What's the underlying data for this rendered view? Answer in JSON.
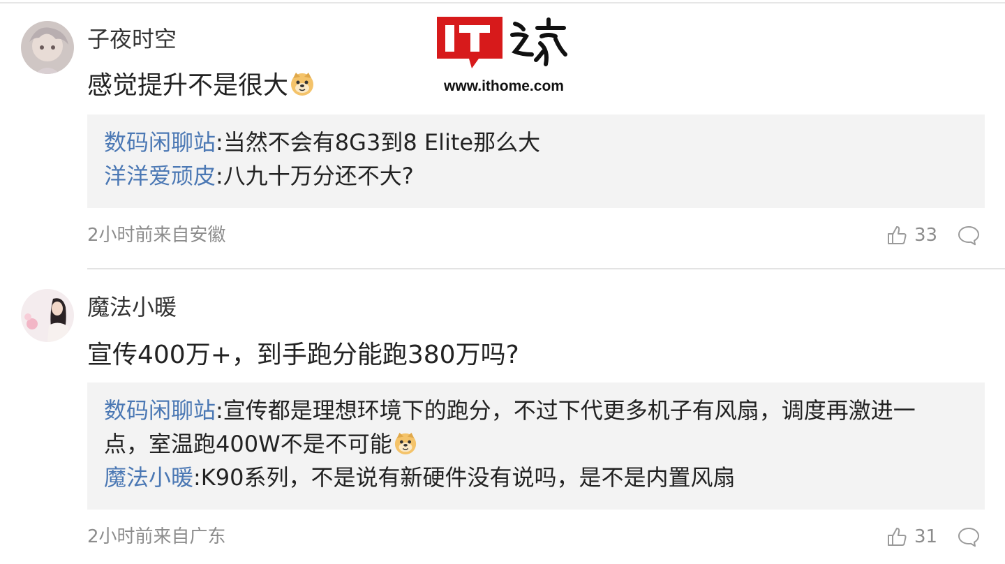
{
  "watermark": {
    "logo_text": "IT之家",
    "url": "www.ithome.com"
  },
  "comments": [
    {
      "username": "子夜时空",
      "content": "感觉提升不是很大",
      "emoji": "doge-emoji",
      "replies": [
        {
          "name": "数码闲聊站",
          "text": ":当然不会有8G3到8 Elite那么大"
        },
        {
          "name": "洋洋爱顽皮",
          "text": ":八九十万分还不大?"
        }
      ],
      "meta": "2小时前来自安徽",
      "likes": "33"
    },
    {
      "username": "魔法小暖",
      "content": "宣传400万+，到手跑分能跑380万吗?",
      "replies": [
        {
          "name": "数码闲聊站",
          "text": ":宣传都是理想环境下的跑分，不过下代更多机子有风扇，调度再激进一",
          "text2": "点，室温跑400W不是不可能",
          "emoji": "doge-emoji"
        },
        {
          "name": "魔法小暖",
          "text": ":K90系列，不是说有新硬件没有说吗，是不是内置风扇"
        }
      ],
      "meta": "2小时前来自广东",
      "likes": "31"
    }
  ],
  "colors": {
    "reply_name": "#4b78b4",
    "reply_bg": "#f3f3f3",
    "meta": "#8c8c8c",
    "logo_red": "#d71a1b"
  },
  "icons": [
    "thumbs-up-icon",
    "comment-bubble-icon",
    "doge-emoji"
  ]
}
